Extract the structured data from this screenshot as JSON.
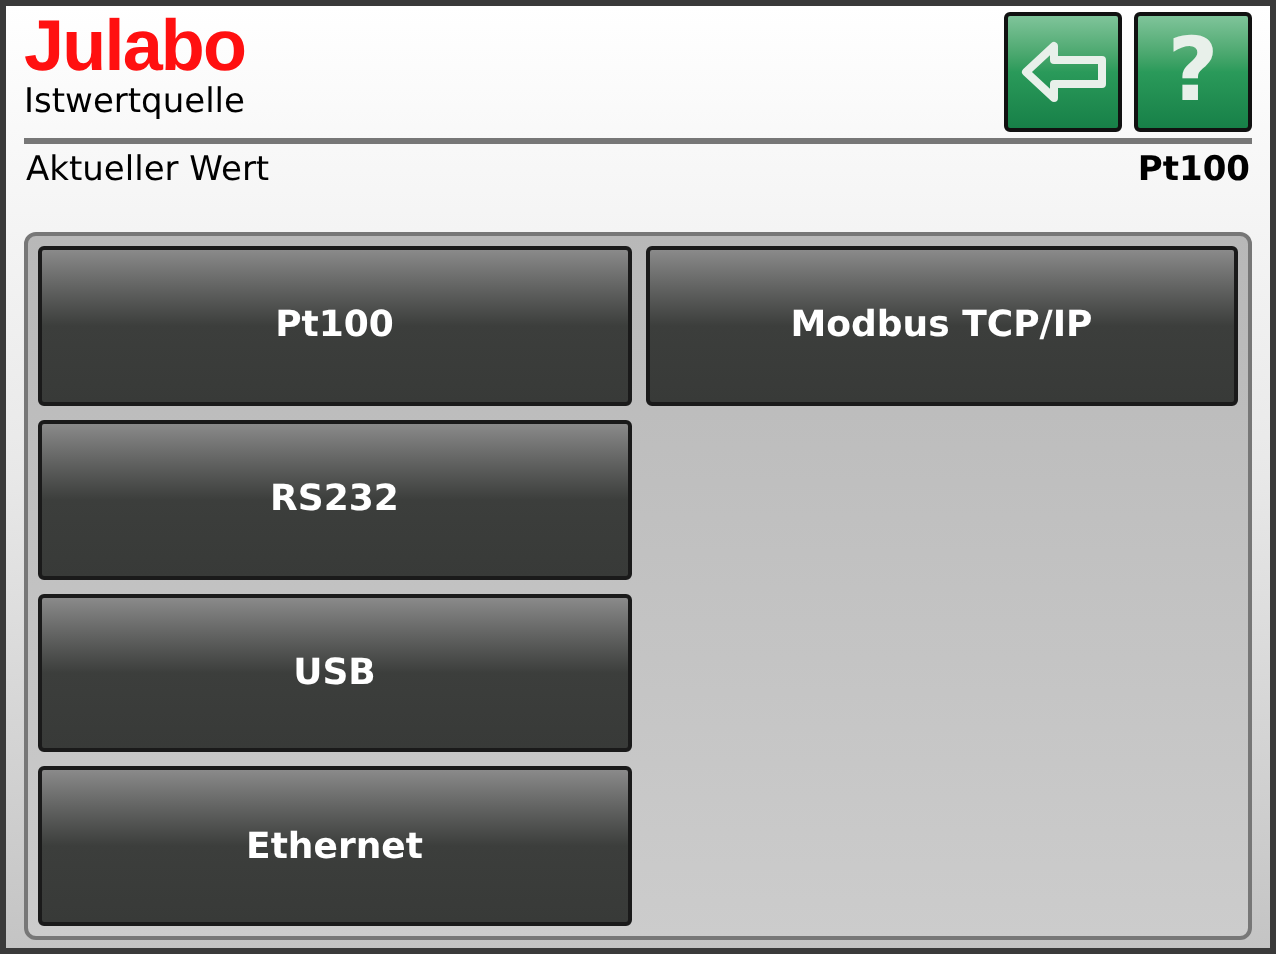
{
  "header": {
    "logo": "Julabo",
    "title": "Istwertquelle"
  },
  "toolbar": [
    {
      "kind": "back"
    },
    {
      "kind": "help",
      "label": "?"
    }
  ],
  "current_value": {
    "label": "Aktueller Wert",
    "value": "Pt100"
  },
  "options": [
    {
      "label": "Pt100"
    },
    {
      "label": "RS232"
    },
    {
      "label": "USB"
    },
    {
      "label": "Ethernet"
    },
    {
      "label": "Modbus TCP/IP"
    }
  ]
}
